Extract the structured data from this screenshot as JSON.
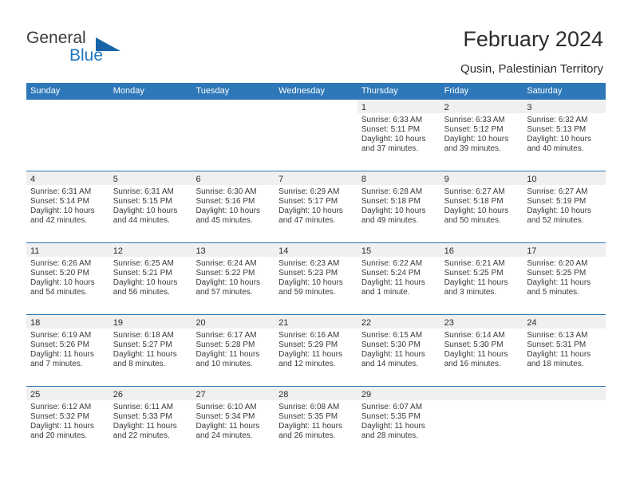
{
  "brand": {
    "name_part1": "General",
    "name_part2": "Blue",
    "triangle_icon": "triangle-icon",
    "accent_color": "#1f76bd"
  },
  "header": {
    "title": "February 2024",
    "location": "Qusin, Palestinian Territory"
  },
  "theme": {
    "header_bar": "#2e77b8",
    "day_band": "#f0f0f0",
    "text": "#2b2b2b"
  },
  "weekdays": [
    "Sunday",
    "Monday",
    "Tuesday",
    "Wednesday",
    "Thursday",
    "Friday",
    "Saturday"
  ],
  "weeks": [
    [
      {
        "day": "",
        "lines": []
      },
      {
        "day": "",
        "lines": []
      },
      {
        "day": "",
        "lines": []
      },
      {
        "day": "",
        "lines": []
      },
      {
        "day": "1",
        "lines": [
          "Sunrise: 6:33 AM",
          "Sunset: 5:11 PM",
          "Daylight: 10 hours",
          "and 37 minutes."
        ]
      },
      {
        "day": "2",
        "lines": [
          "Sunrise: 6:33 AM",
          "Sunset: 5:12 PM",
          "Daylight: 10 hours",
          "and 39 minutes."
        ]
      },
      {
        "day": "3",
        "lines": [
          "Sunrise: 6:32 AM",
          "Sunset: 5:13 PM",
          "Daylight: 10 hours",
          "and 40 minutes."
        ]
      }
    ],
    [
      {
        "day": "4",
        "lines": [
          "Sunrise: 6:31 AM",
          "Sunset: 5:14 PM",
          "Daylight: 10 hours",
          "and 42 minutes."
        ]
      },
      {
        "day": "5",
        "lines": [
          "Sunrise: 6:31 AM",
          "Sunset: 5:15 PM",
          "Daylight: 10 hours",
          "and 44 minutes."
        ]
      },
      {
        "day": "6",
        "lines": [
          "Sunrise: 6:30 AM",
          "Sunset: 5:16 PM",
          "Daylight: 10 hours",
          "and 45 minutes."
        ]
      },
      {
        "day": "7",
        "lines": [
          "Sunrise: 6:29 AM",
          "Sunset: 5:17 PM",
          "Daylight: 10 hours",
          "and 47 minutes."
        ]
      },
      {
        "day": "8",
        "lines": [
          "Sunrise: 6:28 AM",
          "Sunset: 5:18 PM",
          "Daylight: 10 hours",
          "and 49 minutes."
        ]
      },
      {
        "day": "9",
        "lines": [
          "Sunrise: 6:27 AM",
          "Sunset: 5:18 PM",
          "Daylight: 10 hours",
          "and 50 minutes."
        ]
      },
      {
        "day": "10",
        "lines": [
          "Sunrise: 6:27 AM",
          "Sunset: 5:19 PM",
          "Daylight: 10 hours",
          "and 52 minutes."
        ]
      }
    ],
    [
      {
        "day": "11",
        "lines": [
          "Sunrise: 6:26 AM",
          "Sunset: 5:20 PM",
          "Daylight: 10 hours",
          "and 54 minutes."
        ]
      },
      {
        "day": "12",
        "lines": [
          "Sunrise: 6:25 AM",
          "Sunset: 5:21 PM",
          "Daylight: 10 hours",
          "and 56 minutes."
        ]
      },
      {
        "day": "13",
        "lines": [
          "Sunrise: 6:24 AM",
          "Sunset: 5:22 PM",
          "Daylight: 10 hours",
          "and 57 minutes."
        ]
      },
      {
        "day": "14",
        "lines": [
          "Sunrise: 6:23 AM",
          "Sunset: 5:23 PM",
          "Daylight: 10 hours",
          "and 59 minutes."
        ]
      },
      {
        "day": "15",
        "lines": [
          "Sunrise: 6:22 AM",
          "Sunset: 5:24 PM",
          "Daylight: 11 hours",
          "and 1 minute."
        ]
      },
      {
        "day": "16",
        "lines": [
          "Sunrise: 6:21 AM",
          "Sunset: 5:25 PM",
          "Daylight: 11 hours",
          "and 3 minutes."
        ]
      },
      {
        "day": "17",
        "lines": [
          "Sunrise: 6:20 AM",
          "Sunset: 5:25 PM",
          "Daylight: 11 hours",
          "and 5 minutes."
        ]
      }
    ],
    [
      {
        "day": "18",
        "lines": [
          "Sunrise: 6:19 AM",
          "Sunset: 5:26 PM",
          "Daylight: 11 hours",
          "and 7 minutes."
        ]
      },
      {
        "day": "19",
        "lines": [
          "Sunrise: 6:18 AM",
          "Sunset: 5:27 PM",
          "Daylight: 11 hours",
          "and 8 minutes."
        ]
      },
      {
        "day": "20",
        "lines": [
          "Sunrise: 6:17 AM",
          "Sunset: 5:28 PM",
          "Daylight: 11 hours",
          "and 10 minutes."
        ]
      },
      {
        "day": "21",
        "lines": [
          "Sunrise: 6:16 AM",
          "Sunset: 5:29 PM",
          "Daylight: 11 hours",
          "and 12 minutes."
        ]
      },
      {
        "day": "22",
        "lines": [
          "Sunrise: 6:15 AM",
          "Sunset: 5:30 PM",
          "Daylight: 11 hours",
          "and 14 minutes."
        ]
      },
      {
        "day": "23",
        "lines": [
          "Sunrise: 6:14 AM",
          "Sunset: 5:30 PM",
          "Daylight: 11 hours",
          "and 16 minutes."
        ]
      },
      {
        "day": "24",
        "lines": [
          "Sunrise: 6:13 AM",
          "Sunset: 5:31 PM",
          "Daylight: 11 hours",
          "and 18 minutes."
        ]
      }
    ],
    [
      {
        "day": "25",
        "lines": [
          "Sunrise: 6:12 AM",
          "Sunset: 5:32 PM",
          "Daylight: 11 hours",
          "and 20 minutes."
        ]
      },
      {
        "day": "26",
        "lines": [
          "Sunrise: 6:11 AM",
          "Sunset: 5:33 PM",
          "Daylight: 11 hours",
          "and 22 minutes."
        ]
      },
      {
        "day": "27",
        "lines": [
          "Sunrise: 6:10 AM",
          "Sunset: 5:34 PM",
          "Daylight: 11 hours",
          "and 24 minutes."
        ]
      },
      {
        "day": "28",
        "lines": [
          "Sunrise: 6:08 AM",
          "Sunset: 5:35 PM",
          "Daylight: 11 hours",
          "and 26 minutes."
        ]
      },
      {
        "day": "29",
        "lines": [
          "Sunrise: 6:07 AM",
          "Sunset: 5:35 PM",
          "Daylight: 11 hours",
          "and 28 minutes."
        ]
      },
      {
        "day": "",
        "lines": []
      },
      {
        "day": "",
        "lines": []
      }
    ]
  ]
}
